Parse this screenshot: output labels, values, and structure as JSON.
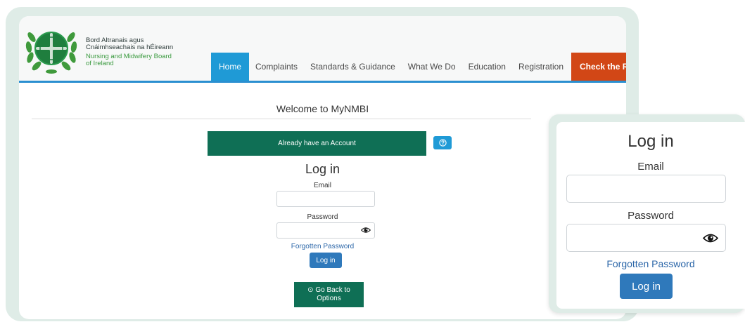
{
  "brand": {
    "irish_line_1": "Bord Altranais agus",
    "irish_line_2": "Cnáimhseachais na hÉireann",
    "english_line_1": "Nursing and Midwifery Board",
    "english_line_2": "of Ireland",
    "logo_icon": "nmbi-crest-icon"
  },
  "nav": {
    "items": [
      {
        "label": "Home",
        "active": true
      },
      {
        "label": "Complaints",
        "active": false
      },
      {
        "label": "Standards & Guidance",
        "active": false
      },
      {
        "label": "What We Do",
        "active": false
      },
      {
        "label": "Education",
        "active": false
      },
      {
        "label": "Registration",
        "active": false
      }
    ],
    "cta_label": "Check the Register"
  },
  "main": {
    "welcome": "Welcome to MyNMBI",
    "account_button": "Already have an Account",
    "help_icon": "question-circle-icon",
    "login": {
      "title": "Log in",
      "email_label": "Email",
      "email_value": "",
      "password_label": "Password",
      "password_value": "",
      "forgot_link": "Forgotten Password",
      "login_button": "Log in"
    },
    "back_button_icon": "⊙",
    "back_button_line_1": "Go Back to",
    "back_button_line_2": "Options"
  },
  "zoom": {
    "title": "Log in",
    "email_label": "Email",
    "password_label": "Password",
    "forgot_link": "Forgotten Password",
    "login_button": "Log in"
  },
  "colors": {
    "nav_active": "#1f9ad6",
    "cta": "#d24716",
    "brand_green": "#0f6f55",
    "link_blue": "#2b66a8",
    "button_blue": "#2f79bb",
    "frame_mint": "#dfece7"
  }
}
